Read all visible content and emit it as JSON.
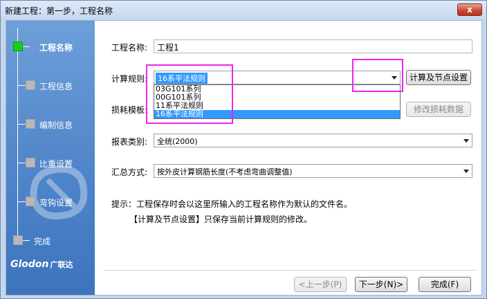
{
  "window": {
    "title": "新建工程：第一步，工程名称",
    "close_label": "x"
  },
  "sidebar": {
    "steps": [
      {
        "label": "工程名称",
        "active": true
      },
      {
        "label": "工程信息",
        "active": false
      },
      {
        "label": "编制信息",
        "active": false
      },
      {
        "label": "比重设置",
        "active": false
      },
      {
        "label": "弯钩设置",
        "active": false
      },
      {
        "label": "完成",
        "active": false
      }
    ],
    "brand_text": "Glodon",
    "brand_cn": "广联达"
  },
  "form": {
    "project_name_label": "工程名称:",
    "project_name_value": "工程1",
    "calc_rule_label": "计算规则:",
    "calc_rule_value": "16系平法规则",
    "calc_rule_options": [
      "03G101系列",
      "00G101系列",
      "11系平法规则",
      "16系平法规则"
    ],
    "calc_settings_button": "计算及节点设置",
    "loss_template_label": "损耗模板:",
    "modify_loss_button": "修改损耗数据",
    "report_type_label": "报表类别:",
    "report_type_value": "全统(2000)",
    "summary_label": "汇总方式:",
    "summary_value": "按外皮计算钢筋长度(不考虑弯曲调整值)",
    "hint_line1": "提示：工程保存时会以这里所输入的工程名称作为默认的文件名。",
    "hint_line2": "【计算及节点设置】只保存当前计算规则的修改。"
  },
  "footer": {
    "prev_button": "<上一步(P)",
    "next_button": "下一步(N)>",
    "finish_button": "完成(F)"
  },
  "colors": {
    "sidebar": "#4f85c9",
    "active_step": "#13d111",
    "selection": "#3399ff",
    "highlight": "#ee22ee"
  }
}
